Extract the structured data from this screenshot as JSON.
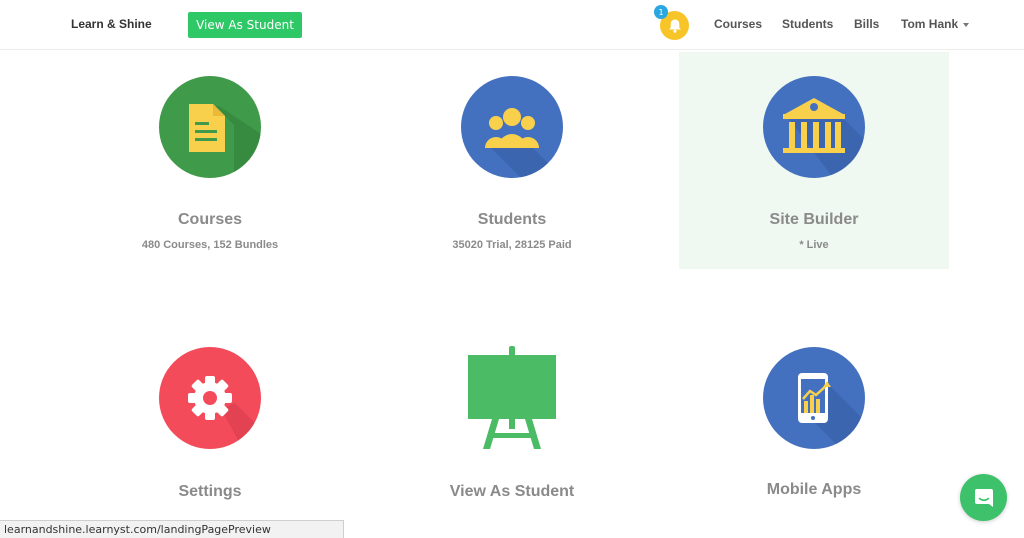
{
  "header": {
    "brand": "Learn & Shine",
    "view_as_student_label": "View As Student",
    "notification_count": "1",
    "nav": [
      "Courses",
      "Students",
      "Bills"
    ],
    "user_name": "Tom Hank"
  },
  "tiles": [
    {
      "title": "Courses",
      "subtitle": "480 Courses, 152 Bundles",
      "icon": "document-icon",
      "color": "#3f9a4a"
    },
    {
      "title": "Students",
      "subtitle": "35020 Trial, 28125 Paid",
      "icon": "group-icon",
      "color": "#4471bf"
    },
    {
      "title": "Site Builder",
      "subtitle": "* Live",
      "icon": "building-icon",
      "color": "#4471bf"
    },
    {
      "title": "Settings",
      "subtitle": "",
      "icon": "gear-icon",
      "color": "#f44b5b"
    },
    {
      "title": "View As Student",
      "subtitle": "",
      "icon": "easel-icon",
      "color": "#4cbb66"
    },
    {
      "title": "Mobile Apps",
      "subtitle": "",
      "icon": "mobile-chart-icon",
      "color": "#4471bf"
    }
  ],
  "status_url": "learnandshine.learnyst.com/landingPagePreview",
  "colors": {
    "accent_green": "#2ec866",
    "bell_yellow": "#f7c527",
    "badge_blue": "#2aa7e0",
    "icon_yellow": "#f8d04c",
    "highlight": "#eff8f1",
    "chat_green": "#3ec16b"
  }
}
